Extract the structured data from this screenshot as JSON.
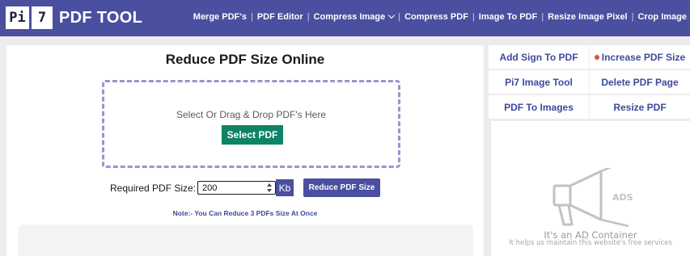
{
  "brand": {
    "logo_part1": "Pi",
    "logo_part2": "7",
    "logo_text": "PDF TOOL"
  },
  "nav": [
    {
      "label": "Merge PDF's"
    },
    {
      "label": "PDF Editor"
    },
    {
      "label": "Compress Image",
      "has_dropdown": true
    },
    {
      "label": "Compress PDF"
    },
    {
      "label": "Image To PDF"
    },
    {
      "label": "Resize Image Pixel"
    },
    {
      "label": "Crop Image"
    }
  ],
  "main": {
    "title": "Reduce PDF Size Online",
    "drop_text": "Select Or Drag & Drop PDF's Here",
    "select_button": "Select PDF",
    "size_label": "Required PDF Size:",
    "size_value": "200",
    "size_unit": "Kb",
    "reduce_button": "Reduce PDF Size",
    "note": "Note:- You Can Reduce 3 PDFs Size At Once"
  },
  "sidebar": {
    "tools": [
      {
        "label": "Add Sign To PDF"
      },
      {
        "label": "Increase PDF Size",
        "highlight": true
      },
      {
        "label": "Pi7 Image Tool"
      },
      {
        "label": "Delete PDF Page"
      },
      {
        "label": "PDF To Images"
      },
      {
        "label": "Resize PDF"
      }
    ],
    "ad": {
      "badge": "ADS",
      "title": "It's an AD Container",
      "subtitle": "It helps us maintain this website's free services"
    }
  },
  "colors": {
    "header_bg": "#4a4fa0",
    "select_button_bg": "#0d8468",
    "link_color": "#3d4a9c",
    "highlight_dot": "#e44b3e",
    "dropzone_border": "#9a95cf"
  }
}
